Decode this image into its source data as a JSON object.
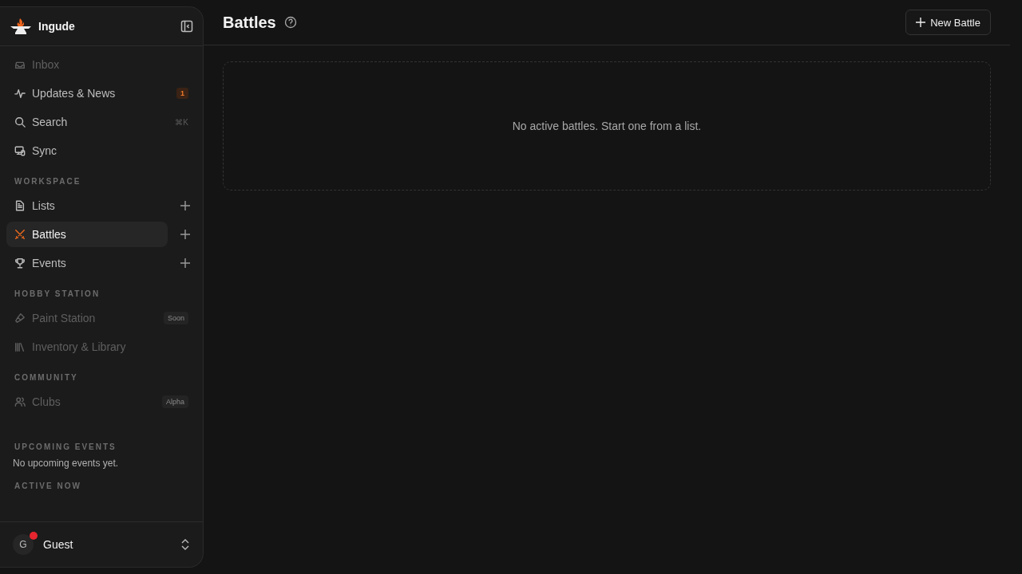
{
  "app": {
    "name": "Ingude"
  },
  "nav": [
    {
      "label": "Inbox",
      "kind": "inbox",
      "disabled": true,
      "selected": false
    },
    {
      "label": "Updates & News",
      "kind": "activity",
      "disabled": false,
      "selected": false,
      "badge": "1"
    },
    {
      "label": "Search",
      "kind": "search",
      "disabled": false,
      "selected": false,
      "shortcut": "⌘K"
    },
    {
      "label": "Sync",
      "kind": "devices",
      "disabled": false,
      "selected": false
    }
  ],
  "sections": [
    {
      "title": "WORKSPACE",
      "items": [
        {
          "label": "Lists",
          "kind": "file",
          "disabled": false,
          "selected": false,
          "add": true
        },
        {
          "label": "Battles",
          "kind": "swords",
          "disabled": false,
          "selected": true,
          "add": true
        },
        {
          "label": "Events",
          "kind": "trophy",
          "disabled": false,
          "selected": false,
          "add": true
        }
      ]
    },
    {
      "title": "HOBBY STATION",
      "items": [
        {
          "label": "Paint Station",
          "kind": "brush",
          "disabled": true,
          "selected": false,
          "tag": "Soon"
        },
        {
          "label": "Inventory & Library",
          "kind": "library",
          "disabled": true,
          "selected": false
        }
      ]
    },
    {
      "title": "COMMUNITY",
      "items": [
        {
          "label": "Clubs",
          "kind": "users",
          "disabled": true,
          "selected": false,
          "tag": "Alpha"
        }
      ]
    }
  ],
  "upcoming": {
    "title": "UPCOMING EVENTS",
    "text": "No upcoming events yet."
  },
  "active_now": {
    "title": "ACTIVE NOW"
  },
  "user": {
    "initial": "G",
    "name": "Guest",
    "notification": true
  },
  "page": {
    "title": "Battles",
    "new_button": "New Battle",
    "empty_text": "No active battles. Start one from a list."
  }
}
